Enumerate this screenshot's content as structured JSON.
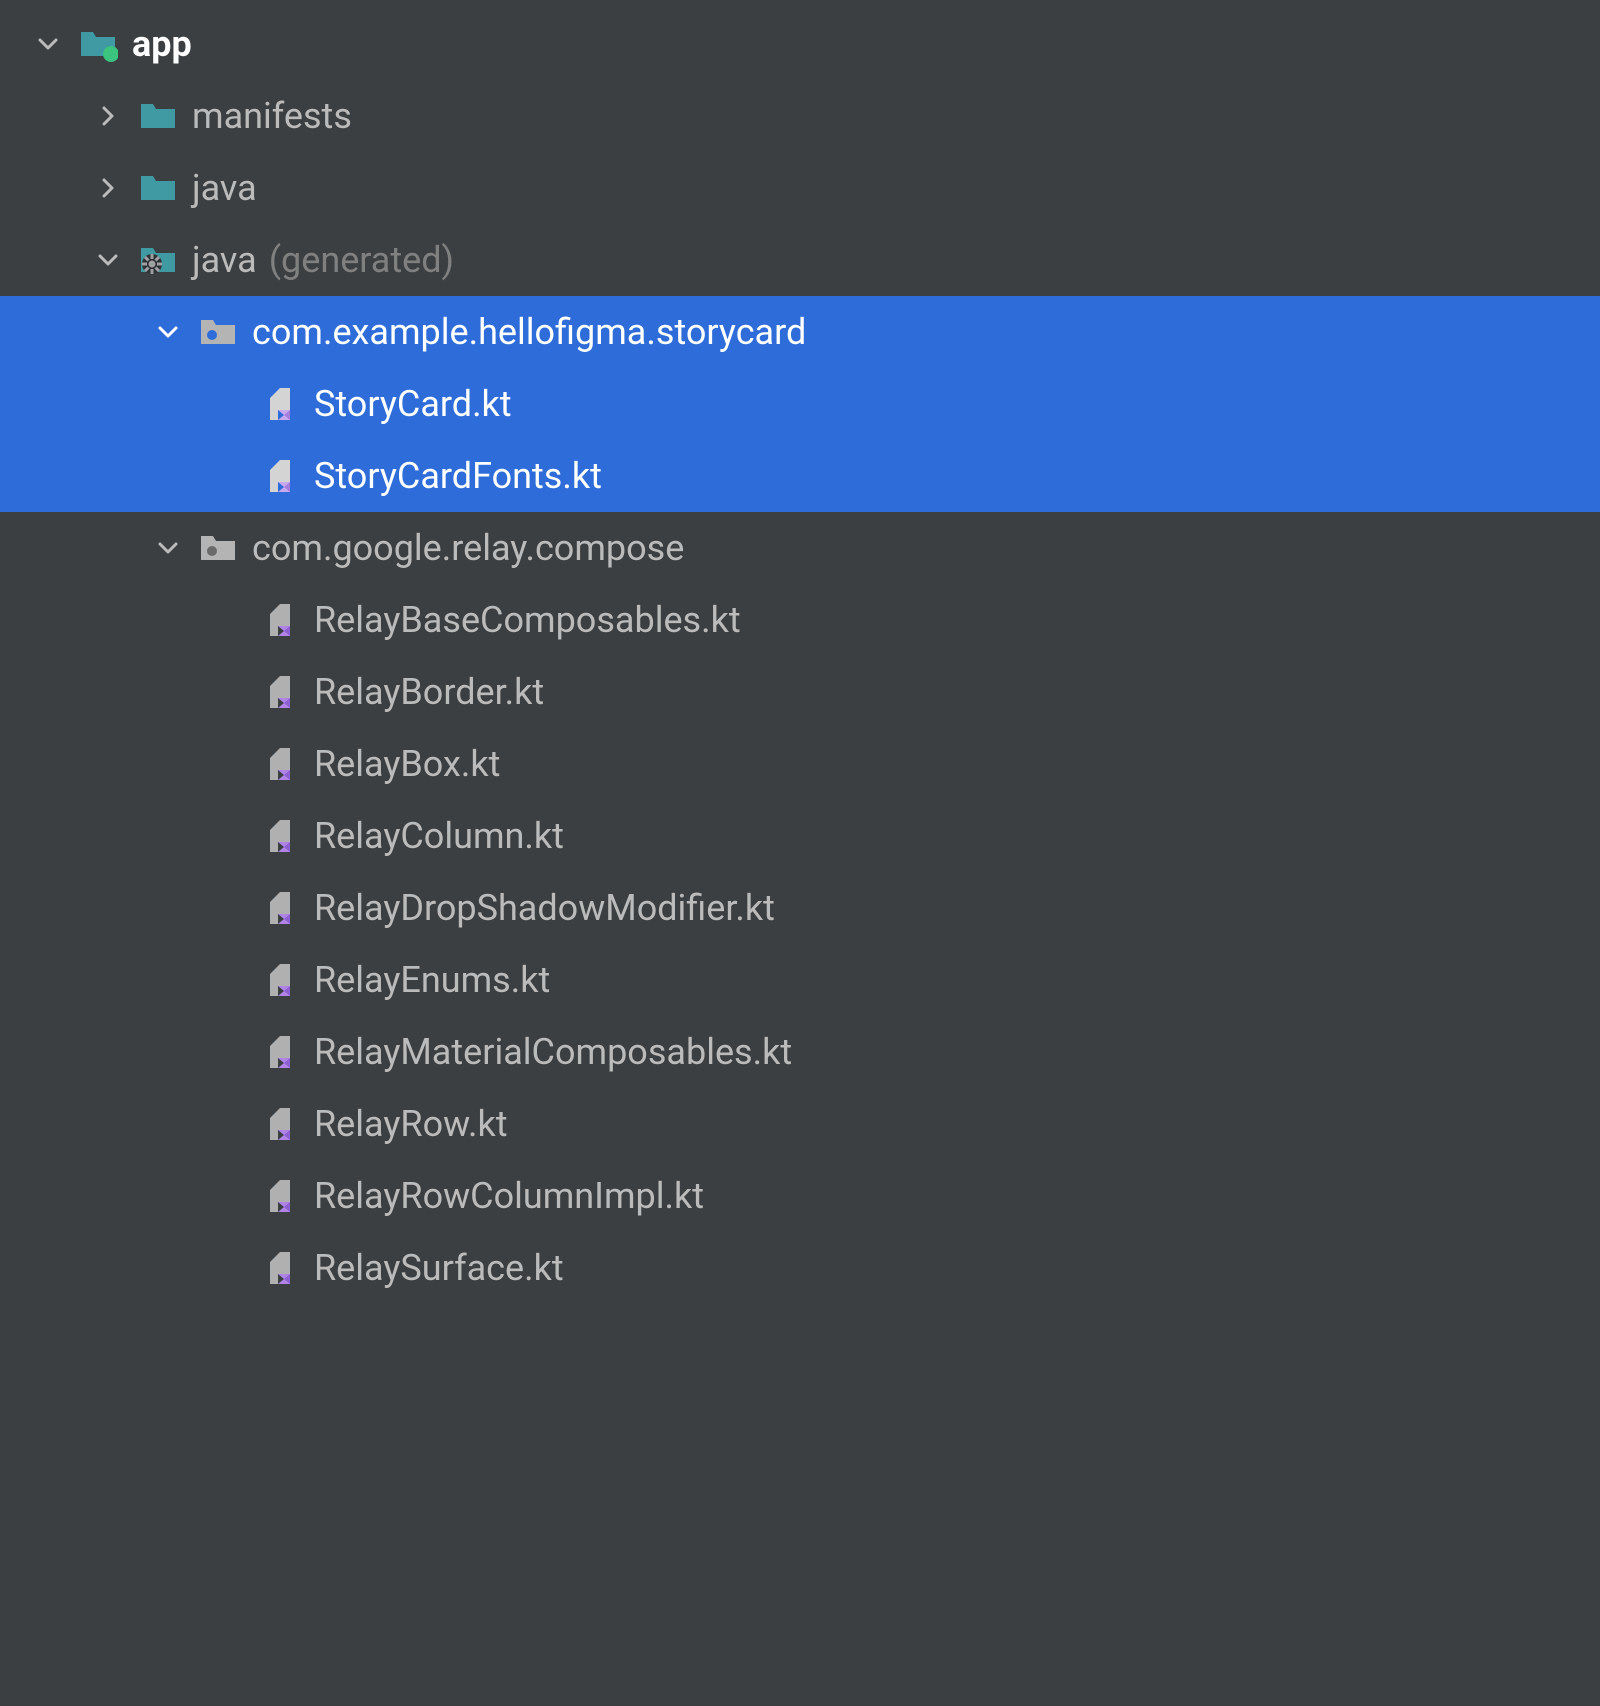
{
  "colors": {
    "bg": "#3c3f41",
    "selected": "#2e6dd9",
    "text": "#bbbbbb",
    "textBold": "#ffffff",
    "suffix": "#808080",
    "folderTeal": "#3f9aa3",
    "folderGrey": "#b4b4b4",
    "folderDot": "#3ac47d",
    "fileGrey": "#b0b0b0",
    "fileAccent": "#b084e8"
  },
  "tree": {
    "root": {
      "label": "app",
      "expanded": true,
      "bold": true
    },
    "children": [
      {
        "label": "manifests",
        "expanded": false,
        "folder": "teal"
      },
      {
        "label": "java",
        "expanded": false,
        "folder": "teal"
      },
      {
        "label": "java",
        "suffix": "(generated)",
        "expanded": true,
        "folder": "gear",
        "children": [
          {
            "label": "com.example.hellofigma.storycard",
            "expanded": true,
            "selected": true,
            "folder": "grey",
            "files": [
              {
                "label": "StoryCard.kt",
                "selected": true
              },
              {
                "label": "StoryCardFonts.kt",
                "selected": true
              }
            ]
          },
          {
            "label": "com.google.relay.compose",
            "expanded": true,
            "folder": "grey",
            "files": [
              {
                "label": "RelayBaseComposables.kt"
              },
              {
                "label": "RelayBorder.kt"
              },
              {
                "label": "RelayBox.kt"
              },
              {
                "label": "RelayColumn.kt"
              },
              {
                "label": "RelayDropShadowModifier.kt"
              },
              {
                "label": "RelayEnums.kt"
              },
              {
                "label": "RelayMaterialComposables.kt"
              },
              {
                "label": "RelayRow.kt"
              },
              {
                "label": "RelayRowColumnImpl.kt"
              },
              {
                "label": "RelaySurface.kt"
              }
            ]
          }
        ]
      }
    ]
  }
}
